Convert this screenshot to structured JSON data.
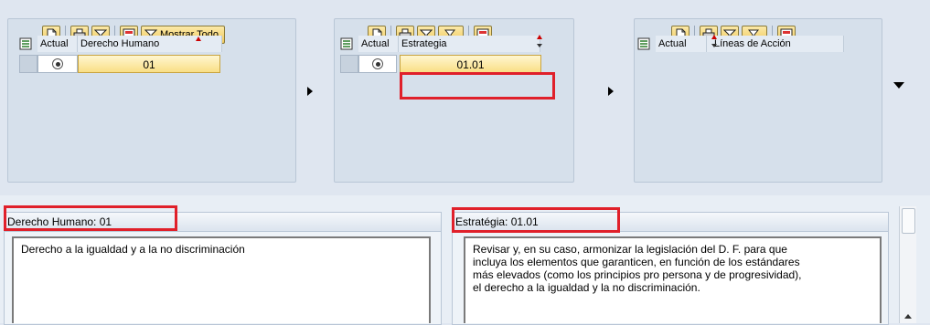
{
  "panel1": {
    "toolbar": {
      "show_all_label": "Mostrar Todo"
    },
    "headers": {
      "current": "Actual",
      "column": "Derecho Humano"
    },
    "row": {
      "value": "01"
    }
  },
  "panel2": {
    "headers": {
      "current": "Actual",
      "column": "Estrategia"
    },
    "row": {
      "value": "01.01"
    }
  },
  "panel3": {
    "headers": {
      "current": "Actual",
      "column": "Líneas de Acción"
    }
  },
  "detail1": {
    "title": "Derecho Humano: 01",
    "text": "Derecho a la igualdad y a la no discriminación"
  },
  "detail2": {
    "title": "Estratégia: 01.01",
    "lines": [
      "Revisar y, en su caso, armonizar la legislación del D. F. para que",
      "incluya los elementos que garanticen, en función de los estándares",
      "más elevados (como los principios pro persona y de progresividad),",
      "el derecho a la igualdad y la no discriminación."
    ]
  },
  "icons": [
    "new-document-icon",
    "print-icon",
    "filter-icon",
    "filter-dropdown-icon",
    "export-icon",
    "show-all-icon",
    "select-all-icon",
    "radio-selected-icon",
    "navigate-next-arrow",
    "dropdown-arrow",
    "scroll-up-icon"
  ],
  "colors": {
    "highlight": "#e0202a",
    "cell_fill": "#f9df86",
    "panel_bg": "#d6e0eb"
  }
}
